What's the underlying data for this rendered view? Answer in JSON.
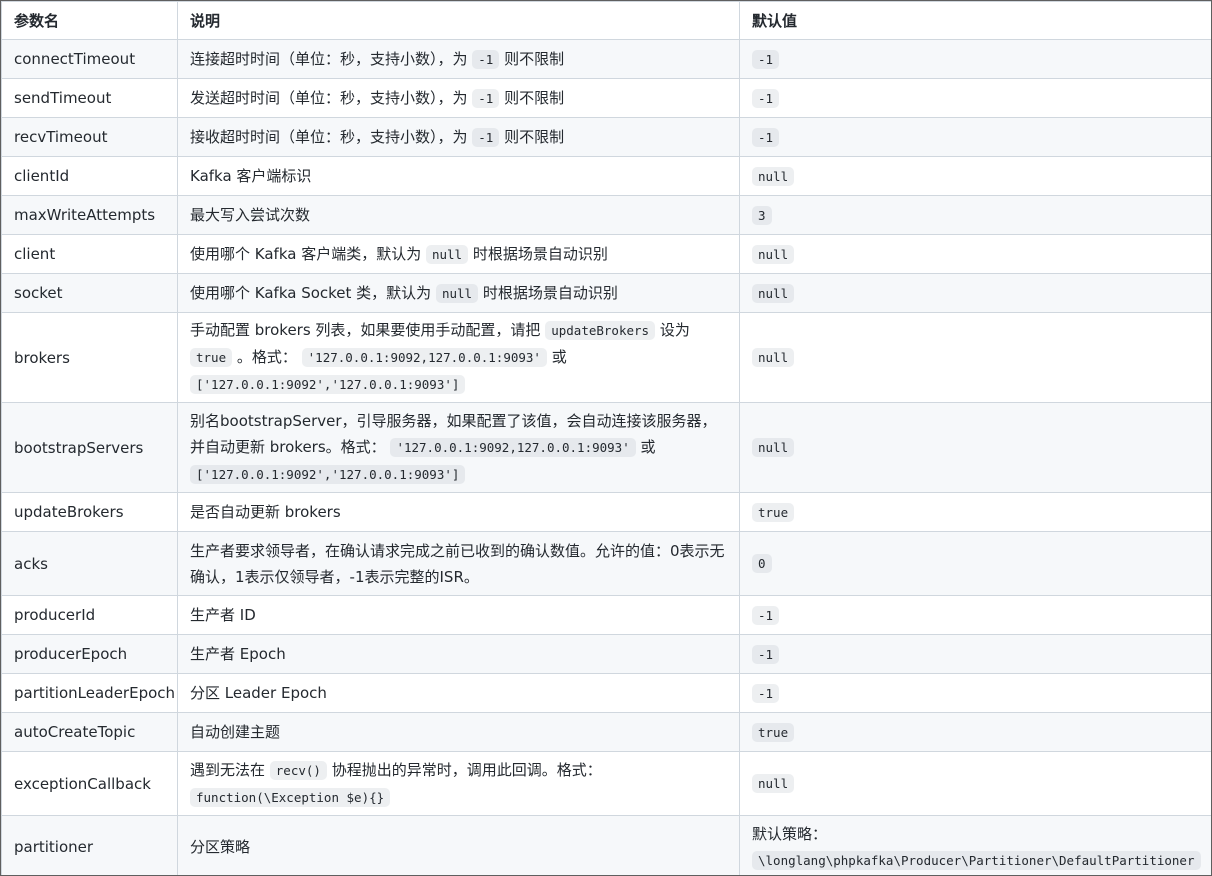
{
  "headers": [
    "参数名",
    "说明",
    "默认值"
  ],
  "rows": [
    {
      "name": "connectTimeout",
      "desc": [
        {
          "t": "连接超时时间（单位：秒，支持小数），为 "
        },
        {
          "c": "-1"
        },
        {
          "t": " 则不限制"
        }
      ],
      "default_pre": "",
      "default_code": "-1"
    },
    {
      "name": "sendTimeout",
      "desc": [
        {
          "t": "发送超时时间（单位：秒，支持小数），为 "
        },
        {
          "c": "-1"
        },
        {
          "t": " 则不限制"
        }
      ],
      "default_pre": "",
      "default_code": "-1"
    },
    {
      "name": "recvTimeout",
      "desc": [
        {
          "t": "接收超时时间（单位：秒，支持小数），为 "
        },
        {
          "c": "-1"
        },
        {
          "t": " 则不限制"
        }
      ],
      "default_pre": "",
      "default_code": "-1"
    },
    {
      "name": "clientId",
      "desc": [
        {
          "t": "Kafka 客户端标识"
        }
      ],
      "default_pre": "",
      "default_code": "null"
    },
    {
      "name": "maxWriteAttempts",
      "desc": [
        {
          "t": "最大写入尝试次数"
        }
      ],
      "default_pre": "",
      "default_code": "3"
    },
    {
      "name": "client",
      "desc": [
        {
          "t": "使用哪个 Kafka 客户端类，默认为 "
        },
        {
          "c": "null"
        },
        {
          "t": " 时根据场景自动识别"
        }
      ],
      "default_pre": "",
      "default_code": "null"
    },
    {
      "name": "socket",
      "desc": [
        {
          "t": "使用哪个 Kafka Socket 类，默认为 "
        },
        {
          "c": "null"
        },
        {
          "t": " 时根据场景自动识别"
        }
      ],
      "default_pre": "",
      "default_code": "null"
    },
    {
      "name": "brokers",
      "desc": [
        {
          "t": "手动配置 brokers 列表，如果要使用手动配置，请把 "
        },
        {
          "c": "updateBrokers"
        },
        {
          "t": " 设为 "
        },
        {
          "c": "true"
        },
        {
          "t": " 。格式： "
        },
        {
          "c": "'127.0.0.1:9092,127.0.0.1:9093'"
        },
        {
          "t": " 或 "
        },
        {
          "c": "['127.0.0.1:9092','127.0.0.1:9093']"
        }
      ],
      "default_pre": "",
      "default_code": "null"
    },
    {
      "name": "bootstrapServers",
      "desc": [
        {
          "t": "别名bootstrapServer，引导服务器，如果配置了该值，会自动连接该服务器，并自动更新 brokers。格式： "
        },
        {
          "c": "'127.0.0.1:9092,127.0.0.1:9093'"
        },
        {
          "t": " 或 "
        },
        {
          "c": "['127.0.0.1:9092','127.0.0.1:9093']"
        }
      ],
      "default_pre": "",
      "default_code": "null"
    },
    {
      "name": "updateBrokers",
      "desc": [
        {
          "t": "是否自动更新 brokers"
        }
      ],
      "default_pre": "",
      "default_code": "true"
    },
    {
      "name": "acks",
      "desc": [
        {
          "t": "生产者要求领导者，在确认请求完成之前已收到的确认数值。允许的值：0表示无确认，1表示仅领导者，-1表示完整的ISR。"
        }
      ],
      "default_pre": "",
      "default_code": "0"
    },
    {
      "name": "producerId",
      "desc": [
        {
          "t": "生产者 ID"
        }
      ],
      "default_pre": "",
      "default_code": "-1"
    },
    {
      "name": "producerEpoch",
      "desc": [
        {
          "t": "生产者 Epoch"
        }
      ],
      "default_pre": "",
      "default_code": "-1"
    },
    {
      "name": "partitionLeaderEpoch",
      "desc": [
        {
          "t": "分区 Leader Epoch"
        }
      ],
      "default_pre": "",
      "default_code": "-1"
    },
    {
      "name": "autoCreateTopic",
      "desc": [
        {
          "t": "自动创建主题"
        }
      ],
      "default_pre": "",
      "default_code": "true"
    },
    {
      "name": "exceptionCallback",
      "desc": [
        {
          "t": "遇到无法在 "
        },
        {
          "c": "recv()"
        },
        {
          "t": " 协程抛出的异常时，调用此回调。格式： "
        },
        {
          "c": "function(\\Exception $e){}"
        }
      ],
      "default_pre": "",
      "default_code": "null"
    },
    {
      "name": "partitioner",
      "desc": [
        {
          "t": "分区策略"
        }
      ],
      "default_pre": "默认策略：",
      "default_code": "\\longlang\\phpkafka\\Producer\\Partitioner\\DefaultPartitioner"
    }
  ]
}
